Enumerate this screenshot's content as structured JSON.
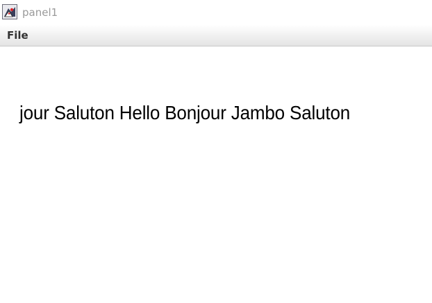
{
  "window": {
    "title": "panel1",
    "icon": "java-duke-icon"
  },
  "menubar": {
    "items": [
      {
        "label": "File"
      }
    ]
  },
  "content": {
    "text": "jour Saluton Hello Bonjour Jambo Saluton"
  }
}
